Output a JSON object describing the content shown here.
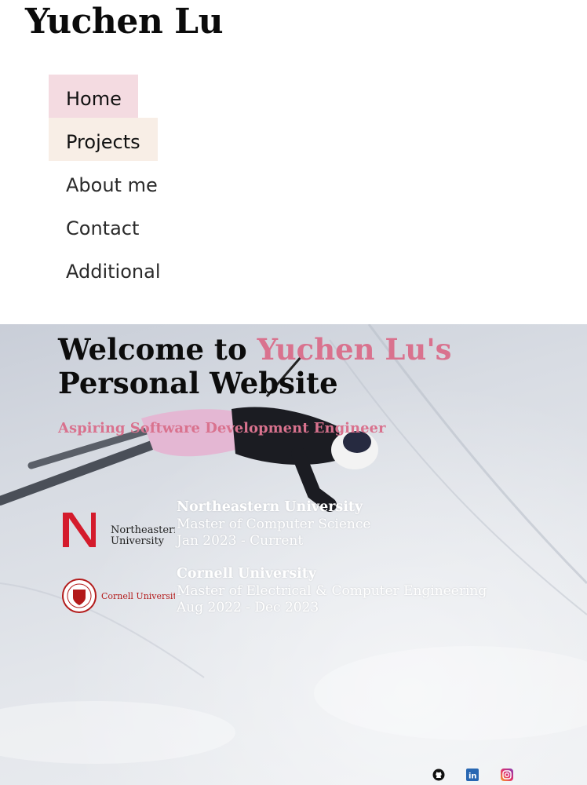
{
  "header": {
    "title": "Yuchen Lu"
  },
  "nav": {
    "items": [
      {
        "label": "Home"
      },
      {
        "label": "Projects"
      },
      {
        "label": "About me"
      },
      {
        "label": "Contact"
      },
      {
        "label": "Additional"
      }
    ]
  },
  "hero": {
    "heading_prefix": "Welcome to ",
    "heading_name": "Yuchen Lu's",
    "heading_suffix": "Personal Website",
    "tagline": "Aspiring Software Development Engineer",
    "background_image": "person making a snow angel on a ski slope"
  },
  "education": [
    {
      "logo_text": "Northeastern University",
      "school": "Northeastern University",
      "degree": "Master of Computer Science",
      "dates": "Jan 2023 - Current"
    },
    {
      "logo_text": "Cornell University",
      "school": "Cornell University",
      "degree": "Master of Electrical & Computer Engineering",
      "dates": "Aug 2022 - Dec 2023"
    }
  ],
  "social": [
    {
      "icon": "github-icon"
    },
    {
      "icon": "linkedin-icon"
    },
    {
      "icon": "instagram-icon"
    }
  ],
  "colors": {
    "accent": "#d9728e",
    "nav_home_bg": "#f4dbe1",
    "nav_projects_bg": "#f8eee6",
    "northeastern_red": "#d41b2c",
    "cornell_red": "#b31b1b"
  }
}
